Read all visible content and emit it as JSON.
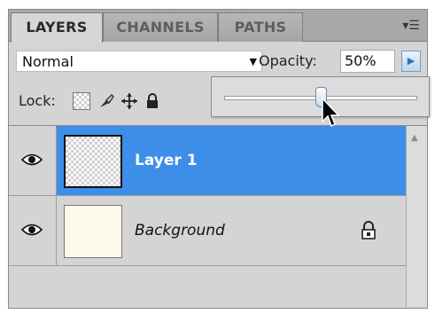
{
  "tabs": [
    {
      "label": "LAYERS",
      "active": true
    },
    {
      "label": "CHANNELS",
      "active": false
    },
    {
      "label": "PATHS",
      "active": false
    }
  ],
  "blend": {
    "mode": "Normal"
  },
  "opacity": {
    "label": "Opacity:",
    "value": "50%",
    "level_percent": 50
  },
  "lock": {
    "label": "Lock:",
    "icons": [
      "lock-transparent-pixels-icon",
      "lock-image-pixels-icon",
      "lock-position-icon",
      "lock-all-icon"
    ]
  },
  "layers": [
    {
      "name": "Layer 1",
      "selected": true,
      "visible": true
    },
    {
      "name": "Background",
      "selected": false,
      "visible": true,
      "locked": true
    }
  ],
  "colors": {
    "selection": "#3d8ee8",
    "panel": "#d4d4d4",
    "tab_bar": "#a9a9a9"
  }
}
